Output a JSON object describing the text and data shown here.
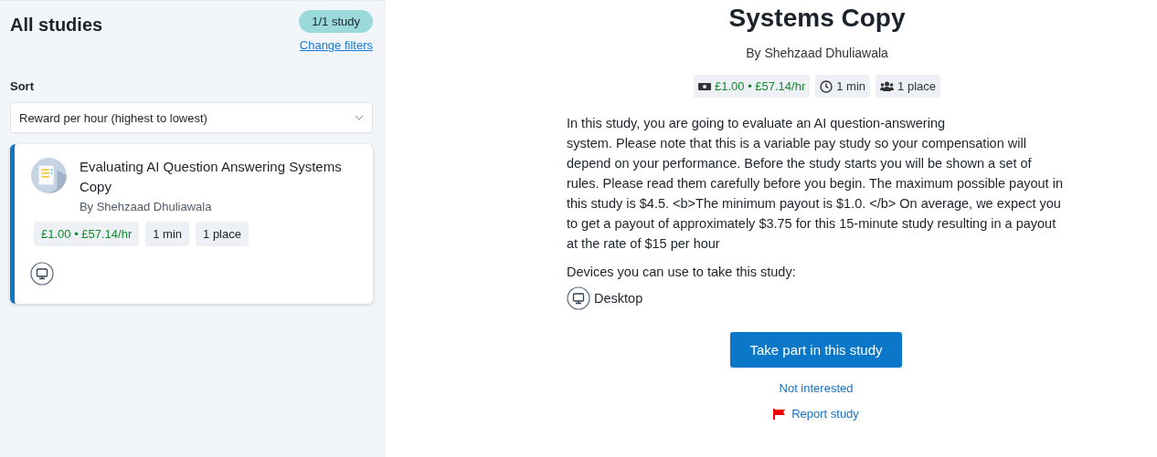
{
  "sidebar": {
    "title": "All studies",
    "count_badge": "1/1 study",
    "change_filters_link": "Change filters",
    "sort": {
      "label": "Sort",
      "value": "Reward per hour (highest to lowest)"
    },
    "studies": [
      {
        "title": "Evaluating AI Question Answering Systems Copy",
        "researcher": "By Shehzaad Dhuliawala",
        "selected": true,
        "tags": [
          {
            "kind": "reward",
            "text": "£1.00 • £57.14/hr"
          },
          {
            "kind": "duration",
            "text": "1 min"
          },
          {
            "kind": "places",
            "text": "1 place"
          }
        ],
        "devices": [
          {
            "kind": "desktop"
          }
        ]
      }
    ]
  },
  "detail": {
    "title": "Systems Copy",
    "researcher": "By Shehzaad Dhuliawala",
    "tags": [
      {
        "kind": "reward",
        "text": "£1.00 • £57.14/hr"
      },
      {
        "kind": "duration",
        "text": "1 min"
      },
      {
        "kind": "places",
        "text": "1 place"
      }
    ],
    "description": "In this study, you are going to evaluate an AI question-answering\nsystem. Please note that this is a variable pay study so your compensation will depend on your performance. Before the study starts you will be shown a set of rules. Please read them carefully before you begin. The maximum possible payout in this study is $4.5. <b>The minimum payout is $1.0. </b> On average, we expect you to get a payout of approximately $3.75 for this 15-minute study resulting in a payout at the rate of $15 per hour",
    "devices_heading": "Devices you can use to take this study:",
    "devices": [
      {
        "kind": "desktop",
        "label": "Desktop"
      }
    ],
    "take_part_button": "Take part in this study",
    "not_interested_link": "Not interested",
    "report_link": "Report study"
  }
}
